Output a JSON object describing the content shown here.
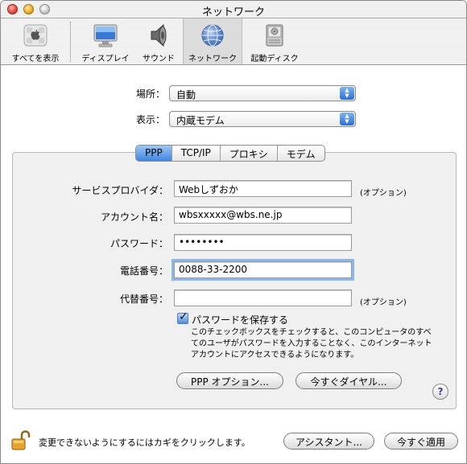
{
  "window": {
    "title": "ネットワーク"
  },
  "toolbar": {
    "items": [
      {
        "label": "すべてを表示",
        "icon": "apple-icon"
      },
      {
        "label": "ディスプレイ",
        "icon": "display-icon"
      },
      {
        "label": "サウンド",
        "icon": "speaker-icon"
      },
      {
        "label": "ネットワーク",
        "icon": "globe-icon",
        "selected": true
      },
      {
        "label": "起動ディスク",
        "icon": "hard-disk-icon"
      }
    ]
  },
  "location": {
    "label": "場所：",
    "value": "自動"
  },
  "show": {
    "label": "表示：",
    "value": "内蔵モデム"
  },
  "tabs": [
    "PPP",
    "TCP/IP",
    "プロキシ",
    "モデム"
  ],
  "active_tab": "PPP",
  "fields": {
    "provider": {
      "label": "サービスプロバイダ：",
      "value": "Webしずおか",
      "note": "(オプション)"
    },
    "account": {
      "label": "アカウント名：",
      "value": "wbsxxxxx@wbs.ne.jp"
    },
    "password": {
      "label": "パスワード：",
      "value": "••••••••"
    },
    "phone": {
      "label": "電話番号：",
      "value": "0088-33-2200"
    },
    "alt_phone": {
      "label": "代替番号：",
      "value": "",
      "note": "(オプション)"
    }
  },
  "save_password": {
    "label": "パスワードを保存する",
    "checked": true,
    "description": "このチェックボックスをチェックすると、このコンピュータのすべてのユーザがパスワードを入力することなく、このインターネットアカウントにアクセスできるようになります。"
  },
  "buttons": {
    "ppp_options": "PPP オプション...",
    "dial_now": "今すぐダイヤル...",
    "help": "?",
    "assistant": "アシスタント...",
    "apply_now": "今すぐ適用"
  },
  "lock_text": "変更できないようにするにはカギをクリックします。",
  "colors": {
    "accent": "#3f85e0",
    "focus_ring": "#8cb6ea"
  }
}
